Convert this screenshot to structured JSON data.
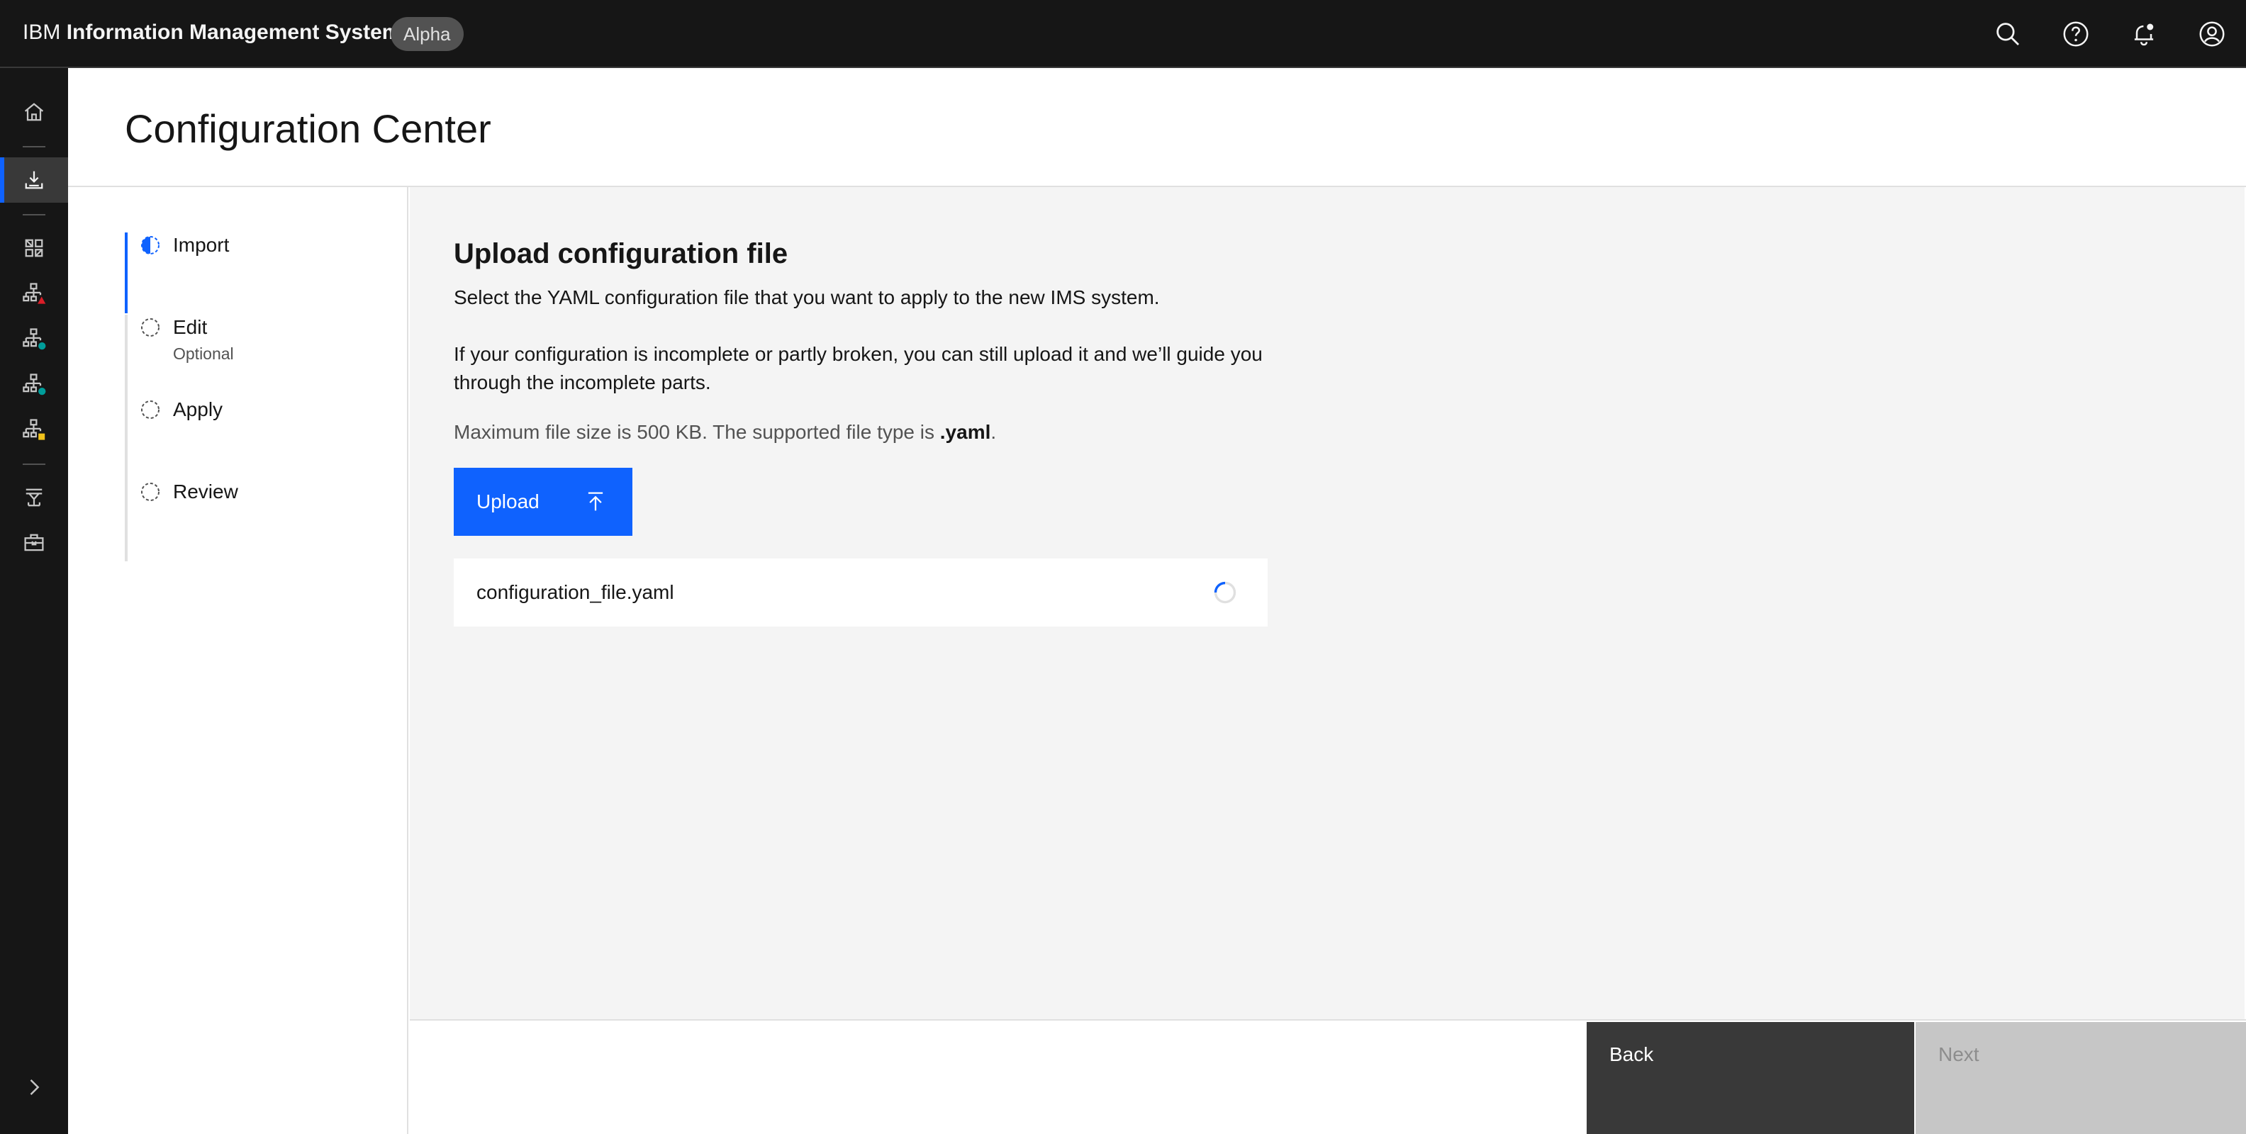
{
  "header": {
    "brand": "IBM",
    "product": "Information Management System",
    "tag": "Alpha",
    "actions": [
      "search-icon",
      "help-icon",
      "notification-icon",
      "user-avatar-icon"
    ]
  },
  "rail": {
    "items": [
      "home-icon",
      "import-icon",
      "dashboard-icon",
      "topology-error-icon",
      "topology-ok-icon",
      "topology-ok-icon",
      "topology-warning-icon",
      "deploy-icon",
      "toolbox-icon"
    ],
    "expand": "chevron-right-icon"
  },
  "page": {
    "title": "Configuration Center"
  },
  "progress": {
    "steps": [
      {
        "label": "Import",
        "sublabel": "",
        "state": "current"
      },
      {
        "label": "Edit",
        "sublabel": "Optional",
        "state": "incomplete"
      },
      {
        "label": "Apply",
        "sublabel": "",
        "state": "incomplete"
      },
      {
        "label": "Review",
        "sublabel": "",
        "state": "incomplete"
      }
    ]
  },
  "upload": {
    "title": "Upload configuration file",
    "description": "Select the YAML configuration file that you want to apply to the new IMS system.",
    "note": "If your configuration is incomplete or partly broken, you can still upload it and we’ll guide you through the incomplete parts.",
    "limit_text": "Maximum file size is 500 KB. The supported file type is ",
    "limit_type": ".yaml",
    "limit_end": ".",
    "button_label": "Upload",
    "file": {
      "name": "configuration_file.yaml",
      "status": "uploading"
    }
  },
  "footer": {
    "back_label": "Back",
    "next_label": "Next"
  },
  "colors": {
    "accent": "#0f62fe",
    "header_bg": "#161616",
    "panel_bg": "#f4f4f4",
    "disabled_bg": "#c6c6c6"
  }
}
